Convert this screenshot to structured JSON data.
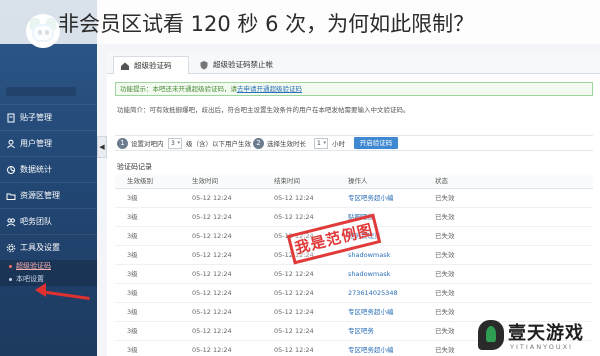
{
  "headline": "非会员区试看 120 秒 6 次，为何如此限制？",
  "colors": {
    "sidebar": "#244a78",
    "accent": "#3f88d2",
    "stamp": "#e03a3a",
    "notice_border": "#9ed59e"
  },
  "sidebar": {
    "user_name": "",
    "menu": [
      {
        "label": "贴子管理",
        "icon": "document-icon"
      },
      {
        "label": "用户管理",
        "icon": "user-icon"
      },
      {
        "label": "数据统计",
        "icon": "chart-icon"
      },
      {
        "label": "资源区管理",
        "icon": "folder-icon"
      },
      {
        "label": "吧务团队",
        "icon": "team-icon"
      },
      {
        "label": "工具及设置",
        "icon": "gear-icon"
      }
    ],
    "submenu": [
      {
        "label": "超级验证码",
        "active": true
      },
      {
        "label": "本吧设置",
        "active": false
      }
    ],
    "collapse_label": "◀"
  },
  "tabs": [
    {
      "label": "超级验证码",
      "icon": "home-icon",
      "active": true
    },
    {
      "label": "超级验证码禁止帐",
      "icon": "shield-icon",
      "active": false
    }
  ],
  "notice": {
    "text": "功能提示：本吧还未开通超级验证码，请",
    "link": "去申请开通超级验证码"
  },
  "intro": "功能简介：可有效抵御爆吧，歧出后，符合吧主设置生效条件的用户在本吧发帖需要输入中文验证码。",
  "settings": {
    "step1_num": "1",
    "step1_text_before": "设置对吧内",
    "step1_select": "3",
    "step1_text_after": "级（含）以下用户生效",
    "step2_num": "2",
    "step2_text": "选择生效时长",
    "step2_select": "1",
    "step2_unit": "小时",
    "submit_label": "开启验证码"
  },
  "records": {
    "title": "验证码记录",
    "columns": [
      "生效级别",
      "生效时间",
      "结束时间",
      "操作人",
      "状态"
    ],
    "rows": [
      [
        "3级",
        "05-12 12:24",
        "05-12 12:24",
        "专区吧务超小编",
        "已失效"
      ],
      [
        "3级",
        "05-12 12:24",
        "05-12 12:24",
        "贴吧吧友",
        "已失效"
      ],
      [
        "3级",
        "05-12 12:24",
        "05-12 12:24",
        "吧务管理员",
        "已失效"
      ],
      [
        "3级",
        "05-12 12:24",
        "05-12 12:24",
        "shadowmask",
        "已失效"
      ],
      [
        "3级",
        "05-12 12:24",
        "05-12 12:24",
        "shadowmask",
        "已失效"
      ],
      [
        "3级",
        "05-12 12:24",
        "05-12 12:24",
        "273614025348",
        "已失效"
      ],
      [
        "3级",
        "05-12 12:24",
        "05-12 12:24",
        "专区吧务超小编",
        "已失效"
      ],
      [
        "3级",
        "05-12 12:24",
        "05-12 12:24",
        "专区吧务",
        "已失效"
      ],
      [
        "3级",
        "05-12 12:24",
        "05-12 12:24",
        "专区吧务超小编",
        "已失效"
      ]
    ]
  },
  "stamp": "我是范例图",
  "watermark": {
    "title": "壹天游戏",
    "subtitle": "YITIANYOUXI"
  }
}
